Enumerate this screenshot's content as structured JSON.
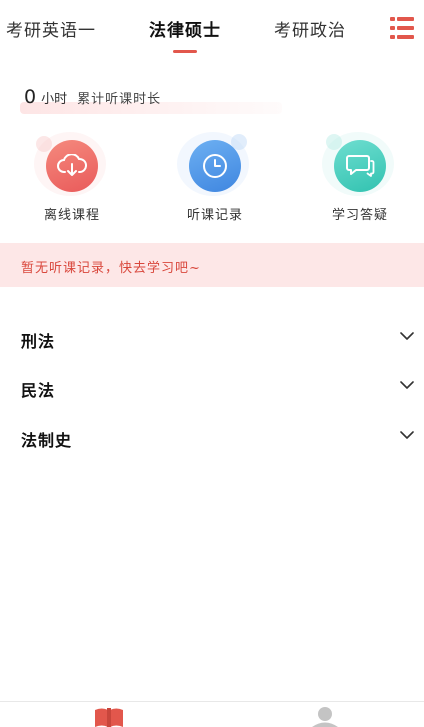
{
  "top_tabs": [
    {
      "label": "考研英语一",
      "active": false
    },
    {
      "label": "法律硕士",
      "active": true
    },
    {
      "label": "考研政治",
      "active": false
    }
  ],
  "study_time": {
    "hours": "0",
    "unit": "小时",
    "description": "累计听课时长"
  },
  "features": [
    {
      "label": "离线课程",
      "icon": "cloud-download-icon",
      "color": "#f06464"
    },
    {
      "label": "听课记录",
      "icon": "clock-icon",
      "color": "#4a90e2"
    },
    {
      "label": "学习答疑",
      "icon": "chat-icon",
      "color": "#3ec8b8"
    }
  ],
  "notice": {
    "text": "暂无听课记录，快去学习吧~"
  },
  "sections": [
    {
      "title": "刑法"
    },
    {
      "title": "民法"
    },
    {
      "title": "法制史"
    }
  ],
  "bottom_nav": [
    {
      "icon": "book-icon",
      "color": "#e2574c"
    },
    {
      "icon": "person-icon",
      "color": "#bbbbbb"
    }
  ],
  "colors": {
    "accent": "#e2574c",
    "notice_bg": "#fde7e7"
  }
}
